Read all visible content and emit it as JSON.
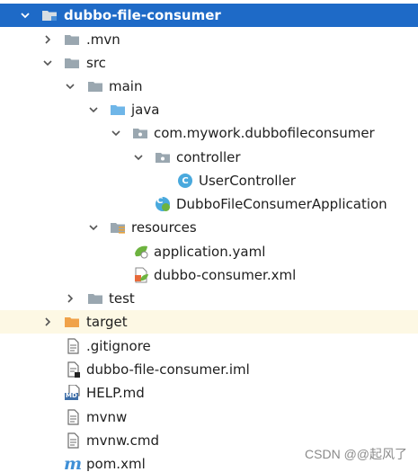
{
  "tree": {
    "root_label": "dubbo-file-consumer",
    "mvn_label": ".mvn",
    "src_label": "src",
    "main_label": "main",
    "java_label": "java",
    "package_label": "com.mywork.dubbofileconsumer",
    "controller_label": "controller",
    "user_controller_label": "UserController",
    "application_class_label": "DubboFileConsumerApplication",
    "resources_label": "resources",
    "application_yaml_label": "application.yaml",
    "consumer_xml_label": "dubbo-consumer.xml",
    "test_label": "test",
    "target_label": "target",
    "gitignore_label": ".gitignore",
    "iml_label": "dubbo-file-consumer.iml",
    "help_label": "HELP.md",
    "mvnw_label": "mvnw",
    "mvnw_cmd_label": "mvnw.cmd",
    "pom_label": "pom.xml"
  },
  "icon_badges": {
    "class_letter": "C",
    "md_badge": "MD",
    "maven_letter": "m"
  },
  "watermark": "CSDN @@起风了",
  "colors": {
    "selection": "#1e6ac7",
    "excluded_row": "#fdf8e4",
    "folder_gray": "#9aa7b0",
    "source_folder_blue": "#6fb6e8",
    "target_orange": "#f0a24a",
    "class_blue": "#49a9dd",
    "spring_green": "#6db33f"
  }
}
